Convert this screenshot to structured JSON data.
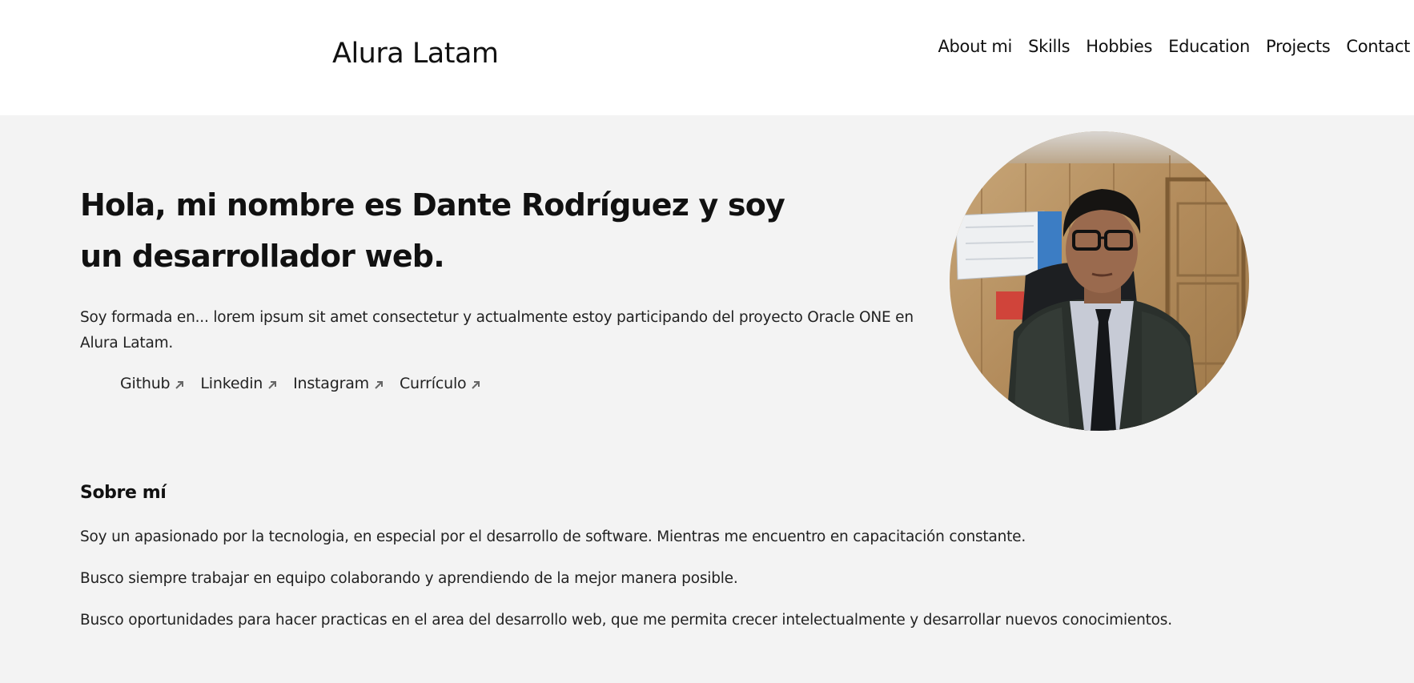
{
  "header": {
    "brand": "Alura Latam",
    "nav": [
      {
        "label": "About mi"
      },
      {
        "label": "Skills"
      },
      {
        "label": "Hobbies"
      },
      {
        "label": "Education"
      },
      {
        "label": "Projects"
      },
      {
        "label": "Contact"
      }
    ]
  },
  "hero": {
    "title": "Hola, mi nombre es Dante Rodríguez y soy un desarrollador web.",
    "description": "Soy formada en... lorem ipsum sit amet consectetur y actualmente estoy participando del proyecto Oracle ONE en Alura Latam.",
    "links": [
      {
        "label": "Github",
        "icon": "external-link-icon"
      },
      {
        "label": "Linkedin",
        "icon": "external-link-icon"
      },
      {
        "label": "Instagram",
        "icon": "external-link-icon"
      },
      {
        "label": "Currículo",
        "icon": "external-link-icon"
      }
    ],
    "avatar_icon": "profile-photo"
  },
  "about": {
    "title": "Sobre mí",
    "paragraphs": [
      "Soy un apasionado por la tecnologia, en especial por el desarrollo de software. Mientras me encuentro en capacitación constante.",
      "Busco siempre trabajar en equipo colaborando y aprendiendo de la mejor manera posible.",
      "Busco oportunidades para hacer practicas en el area del desarrollo web, que me permita crecer intelectualmente y desarrollar nuevos conocimientos."
    ]
  },
  "colors": {
    "header_bg": "#ffffff",
    "main_bg": "#f3f3f3",
    "text": "#111111"
  }
}
